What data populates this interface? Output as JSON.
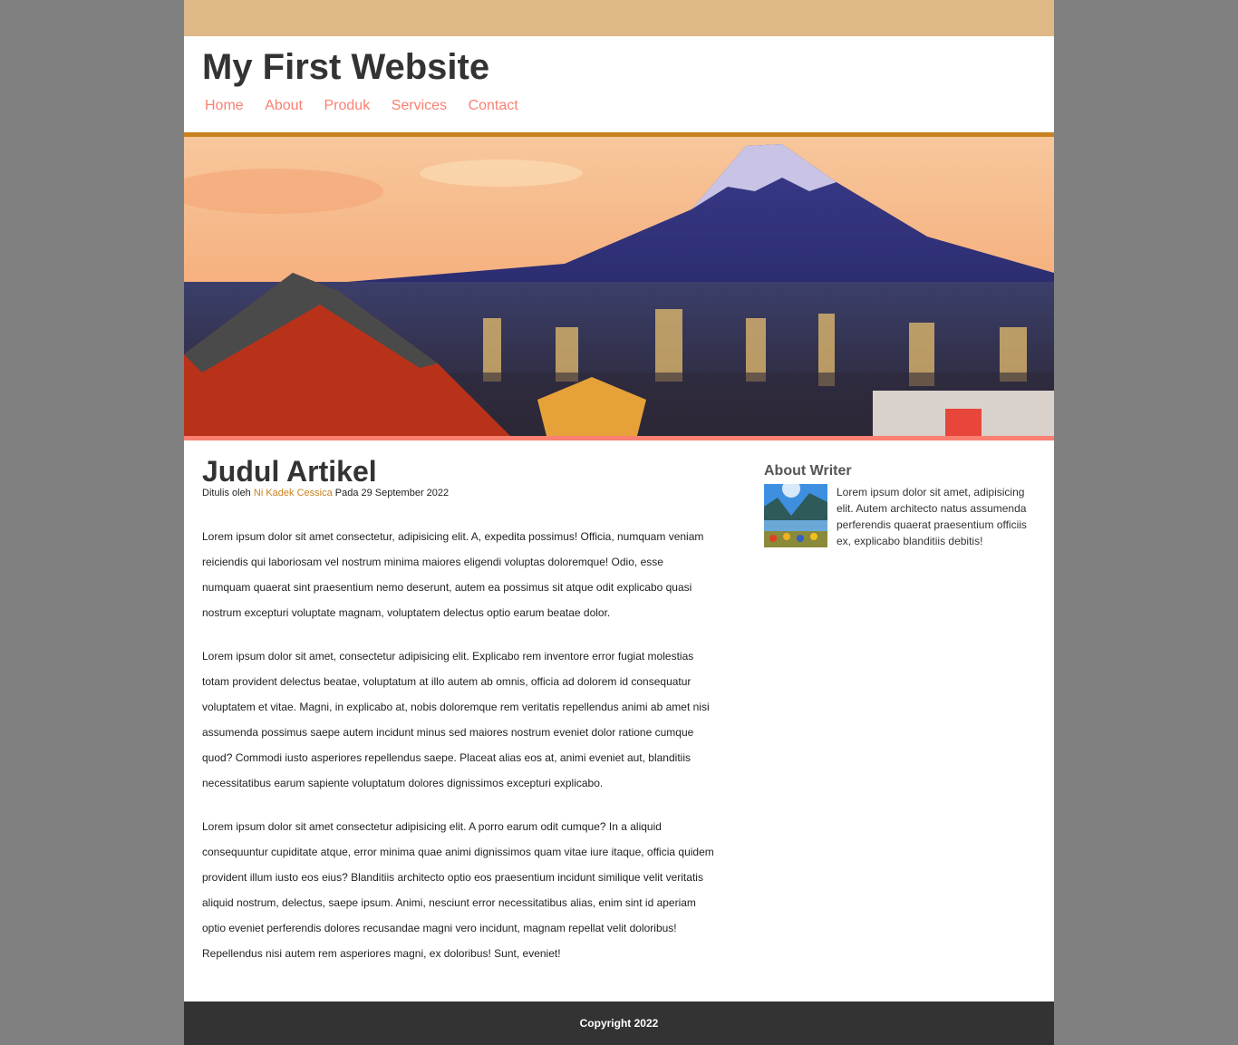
{
  "header": {
    "title": "My First Website"
  },
  "nav": {
    "items": [
      {
        "label": "Home"
      },
      {
        "label": "About"
      },
      {
        "label": "Produk"
      },
      {
        "label": "Services"
      },
      {
        "label": "Contact"
      }
    ]
  },
  "hero": {
    "image": "mount-fuji-tokyo-city-skyline"
  },
  "article": {
    "title": "Judul Artikel",
    "meta_prefix": "Ditulis oleh",
    "author": "Ni Kadek Cessica",
    "meta_date": "Pada 29 September 2022",
    "paragraphs": [
      "Lorem ipsum dolor sit amet consectetur, adipisicing elit. A, expedita possimus! Officia, numquam veniam reiciendis qui laboriosam vel nostrum minima maiores eligendi voluptas doloremque! Odio, esse numquam quaerat sint praesentium nemo deserunt, autem ea possimus sit atque odit explicabo quasi nostrum excepturi voluptate magnam, voluptatem delectus optio earum beatae dolor.",
      "Lorem ipsum dolor sit amet, consectetur adipisicing elit. Explicabo rem inventore error fugiat molestias totam provident delectus beatae, voluptatum at illo autem ab omnis, officia ad dolorem id consequatur voluptatem et vitae. Magni, in explicabo at, nobis doloremque rem veritatis repellendus animi ab amet nisi assumenda possimus saepe autem incidunt minus sed maiores nostrum eveniet dolor ratione cumque quod? Commodi iusto asperiores repellendus saepe. Placeat alias eos at, animi eveniet aut, blanditiis necessitatibus earum sapiente voluptatum dolores dignissimos excepturi explicabo.",
      "Lorem ipsum dolor sit amet consectetur adipisicing elit. A porro earum odit cumque? In a aliquid consequuntur cupiditate atque, error minima quae animi dignissimos quam vitae iure itaque, officia quidem provident illum iusto eos eius? Blanditiis architecto optio eos praesentium incidunt similique velit veritatis aliquid nostrum, delectus, saepe ipsum. Animi, nesciunt error necessitatibus alias, enim sint id aperiam optio eveniet perferendis dolores recusandae magni vero incidunt, magnam repellat velit doloribus! Repellendus nisi autem rem asperiores magni, ex doloribus! Sunt, eveniet!"
    ]
  },
  "sidebar": {
    "title": "About Writer",
    "text": "Lorem ipsum dolor sit amet, adipisicing elit. Autem architecto natus assumenda perferendis quaerat praesentium officiis ex, explicabo blanditiis debitis!"
  },
  "footer": {
    "copyright": "Copyright 2022"
  },
  "colors": {
    "topbar": "#deb887",
    "nav_link": "#fa8072",
    "header_border": "#c8811e",
    "hero_border": "#fa8072",
    "footer": "#333333",
    "background": "#808080"
  }
}
